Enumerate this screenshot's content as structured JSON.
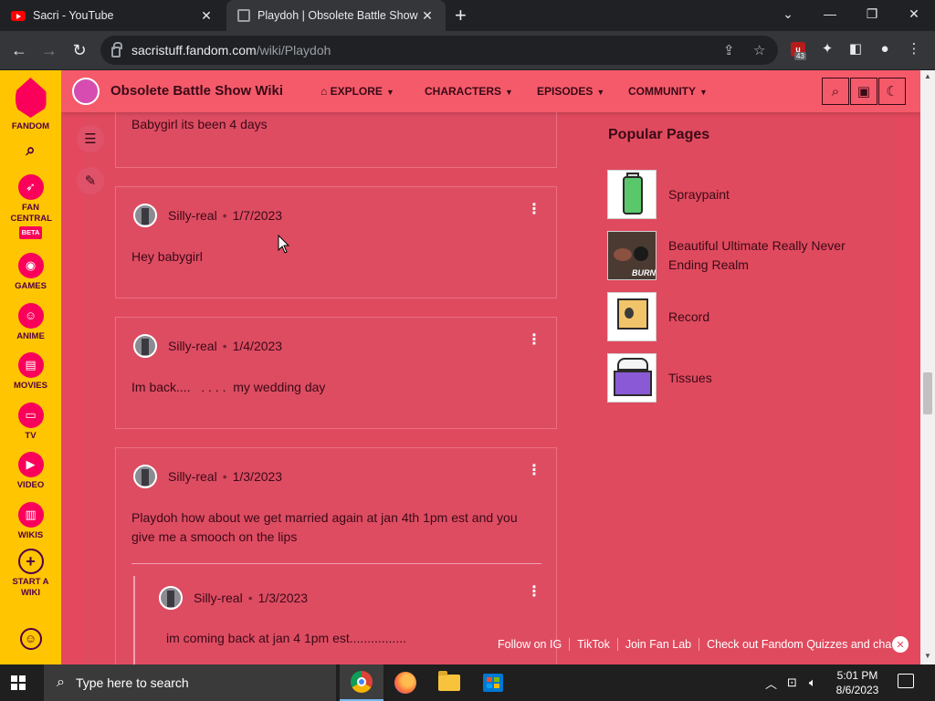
{
  "browser": {
    "tabs": [
      {
        "title": "Sacri - YouTube",
        "icon": "youtube-icon"
      },
      {
        "title": "Playdoh | Obsolete Battle Show W",
        "icon": "fandom-favicon"
      }
    ],
    "new_tab": "+",
    "window_controls": {
      "dropdown": "⌄",
      "minimize": "—",
      "restore": "❐",
      "close": "✕"
    },
    "url_host": "sacristuff.fandom.com",
    "url_path": "/wiki/Playdoh",
    "extension_badge": "43"
  },
  "fandom_nav": {
    "items": [
      {
        "label": "FANDOM"
      },
      {
        "label": "FAN CENTRAL",
        "badge": "BETA"
      },
      {
        "label": "GAMES"
      },
      {
        "label": "ANIME"
      },
      {
        "label": "MOVIES"
      },
      {
        "label": "TV"
      },
      {
        "label": "VIDEO"
      },
      {
        "label": "WIKIS"
      },
      {
        "label": "START A WIKI"
      }
    ]
  },
  "wiki": {
    "name": "Obsolete Battle Show Wiki",
    "nav": {
      "explore": "EXPLORE",
      "characters": "CHARACTERS",
      "episodes": "EPISODES",
      "community": "COMMUNITY"
    }
  },
  "comments": [
    {
      "text": "Babygirl its been 4 days"
    },
    {
      "author": "Silly-real",
      "date": "1/7/2023",
      "text": "Hey babygirl"
    },
    {
      "author": "Silly-real",
      "date": "1/4/2023",
      "text": "Im back....   . . . .  my wedding day"
    },
    {
      "author": "Silly-real",
      "date": "1/3/2023",
      "text": "Playdoh how about we get married again at jan 4th 1pm est and you give me a smooch on the lips"
    }
  ],
  "reply": {
    "author": "Silly-real",
    "date": "1/3/2023",
    "text": "im coming back at jan 4 1pm est................"
  },
  "popular": {
    "title": "Popular Pages",
    "items": [
      {
        "label": "Spraypaint"
      },
      {
        "label": "Beautiful Ultimate Really Never Ending Realm",
        "thumb_text": "BURN"
      },
      {
        "label": "Record"
      },
      {
        "label": "Tissues"
      }
    ]
  },
  "banner": {
    "links": [
      "Follow on IG",
      "TikTok",
      "Join Fan Lab",
      "Check out Fandom Quizzes and cha"
    ]
  },
  "taskbar": {
    "search_placeholder": "Type here to search",
    "time": "5:01 PM",
    "date": "8/6/2023"
  },
  "colors": {
    "page_bg": "#e4485e",
    "wiki_header": "#f55a6a",
    "fandom_rail": "#ffc500",
    "fandom_accent": "#fa005a"
  }
}
